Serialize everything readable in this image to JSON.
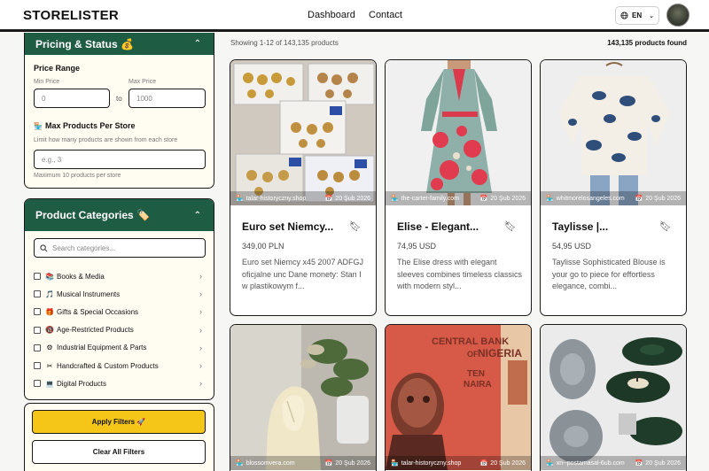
{
  "header": {
    "logo": "STORELISTER",
    "nav": [
      "Dashboard",
      "Contact"
    ],
    "language": "EN"
  },
  "pricing": {
    "title": "Pricing & Status 💰",
    "price_range_label": "Price Range",
    "min_label": "Min Price",
    "max_label": "Max Price",
    "min_placeholder": "0",
    "max_placeholder": "1000",
    "to_label": "to",
    "max_products_label": "Max Products Per Store",
    "max_products_help": "Limit how many products are shown from each store",
    "max_products_placeholder": "e.g., 3",
    "max_products_note": "Maximum 10 products per store"
  },
  "categories": {
    "title": "Product Categories 🏷️",
    "search_placeholder": "Search categories...",
    "items": [
      {
        "icon": "📚",
        "label": "Books & Media"
      },
      {
        "icon": "🎵",
        "label": "Musical Instruments"
      },
      {
        "icon": "🎁",
        "label": "Gifts & Special Occasions"
      },
      {
        "icon": "🔞",
        "label": "Age-Restricted Products"
      },
      {
        "icon": "⚙",
        "label": "Industrial Equipment & Parts"
      },
      {
        "icon": "✂",
        "label": "Handcrafted & Custom Products"
      },
      {
        "icon": "💻",
        "label": "Digital Products"
      }
    ]
  },
  "buttons": {
    "apply": "Apply Filters 🚀",
    "clear": "Clear All Filters"
  },
  "results": {
    "showing": "Showing 1-12 of 143,135 products",
    "found": "143,135 products found"
  },
  "products": [
    {
      "store": "talar-historyczny.shop",
      "date": "20 Şub 2026",
      "title": "Euro set Niemcy...",
      "price": "349,00 PLN",
      "desc": "Euro set Niemcy x45 2007 ADFGJ oficjalne unc Dane monety: Stan I w plastikowym f..."
    },
    {
      "store": "the-carter-family.com",
      "date": "20 Şub 2026",
      "title": "Elise - Elegant...",
      "price": "74,95 USD",
      "desc": "The Elise dress with elegant sleeves combines timeless classics with modern styl..."
    },
    {
      "store": "whitmorelosangeles.com",
      "date": "20 Şub 2026",
      "title": "Taylisse |...",
      "price": "54,95 USD",
      "desc": "Taylisse Sophisticated Blouse is your go to piece for effortless elegance, combi..."
    },
    {
      "store": "blossomvera.com",
      "date": "20 Şub 2026"
    },
    {
      "store": "talar-historyczny.shop",
      "date": "20 Şub 2026",
      "image_text": {
        "bank": "CENTRAL BANK",
        "of": "OF",
        "country": "NIGERIA",
        "denomination": "TEN",
        "currency": "NAIRA"
      }
    },
    {
      "store": "xn--postamasal-6ub.com",
      "date": "20 Şub 2026"
    }
  ]
}
